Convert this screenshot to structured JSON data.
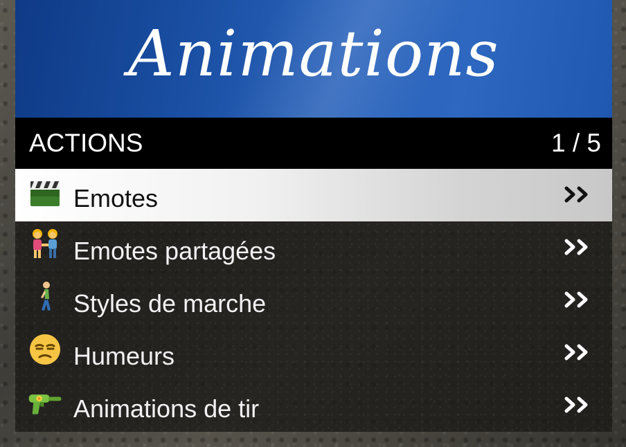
{
  "banner": {
    "title": "Animations"
  },
  "subheader": {
    "title": "ACTIONS",
    "counter": "1 / 5"
  },
  "items": [
    {
      "label": "Emotes",
      "icon": "clapperboard-icon",
      "selected": true
    },
    {
      "label": "Emotes partagées",
      "icon": "couple-holding-hands-icon",
      "selected": false
    },
    {
      "label": "Styles de marche",
      "icon": "person-walking-icon",
      "selected": false
    },
    {
      "label": "Humeurs",
      "icon": "unamused-face-icon",
      "selected": false
    },
    {
      "label": "Animations de tir",
      "icon": "water-pistol-icon",
      "selected": false
    }
  ],
  "colors": {
    "banner_blue": "#2a63bb",
    "header_bg": "#000000",
    "selected_bg": "#e6e6e6",
    "text_light": "#f2f2f2"
  }
}
